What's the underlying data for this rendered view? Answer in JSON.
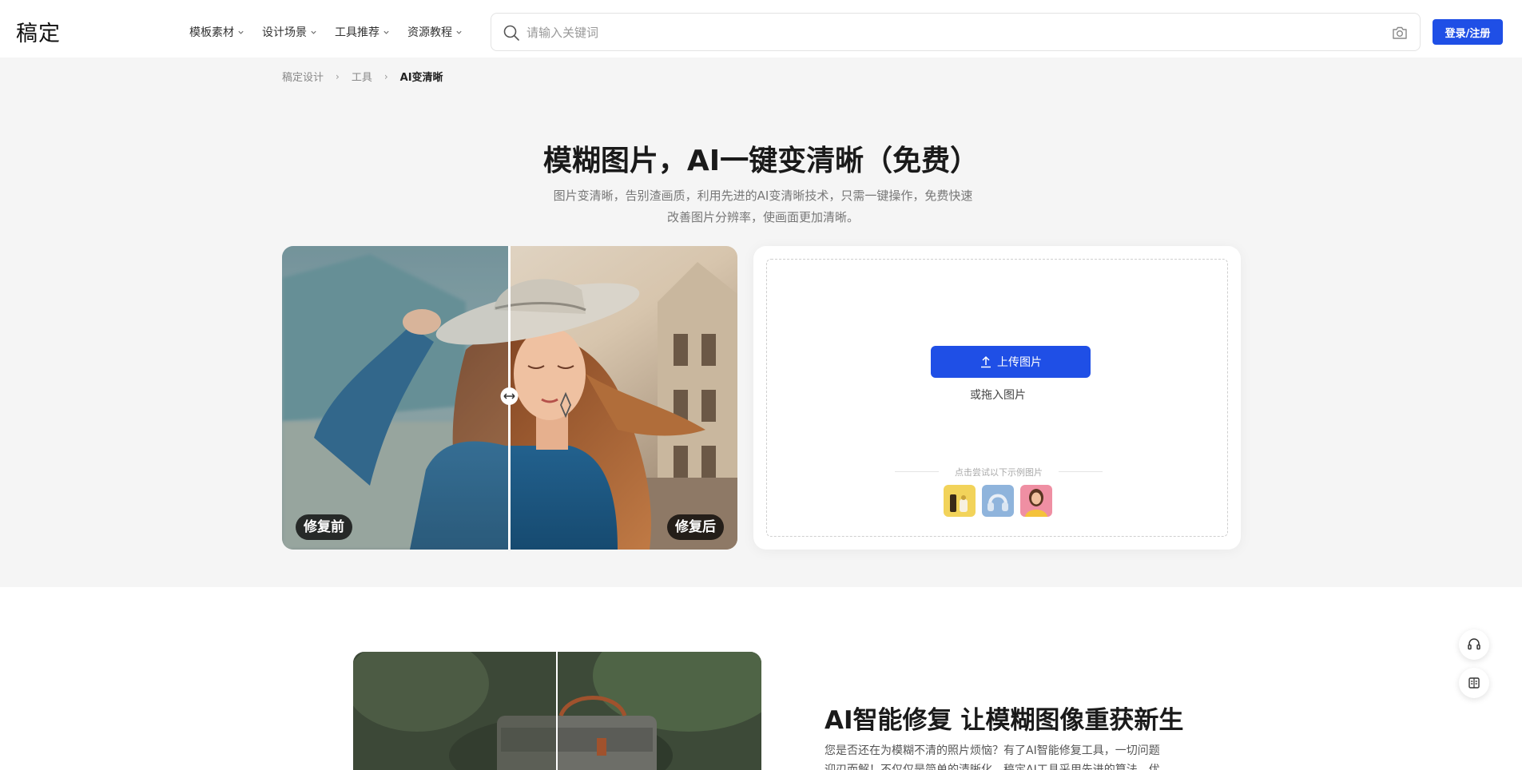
{
  "header": {
    "logo": "稿定",
    "nav": [
      {
        "label": "模板素材"
      },
      {
        "label": "设计场景"
      },
      {
        "label": "工具推荐"
      },
      {
        "label": "资源教程"
      }
    ],
    "search_placeholder": "请输入关键词",
    "login_label": "登录/注册"
  },
  "breadcrumb": {
    "items": [
      "稿定设计",
      "工具"
    ],
    "current": "AI变清晰"
  },
  "hero": {
    "title": "模糊图片，AI一键变清晰（免费）",
    "desc_line1": "图片变清晰，告别渣画质，利用先进的AI变清晰技术，只需一键操作，免费快速",
    "desc_line2": "改善图片分辨率，使画面更加清晰。"
  },
  "compare": {
    "before_label": "修复前",
    "after_label": "修复后"
  },
  "upload": {
    "button_label": "上传图片",
    "drag_text": "或拖入图片",
    "sample_title": "点击尝试以下示例图片",
    "samples": [
      "cosmetics-sample",
      "headphones-sample",
      "portrait-sample"
    ]
  },
  "section2": {
    "title": "AI智能修复 让模糊图像重获新生",
    "desc": "您是否还在为模糊不清的照片烦恼？有了AI智能修复工具，一切问题迎刃而解！不仅仅是简单的清晰化，稿定AI工具采用先进的算法，优"
  },
  "colors": {
    "accent": "#1f4fe6",
    "hero_bg": "#f5f5f5"
  }
}
